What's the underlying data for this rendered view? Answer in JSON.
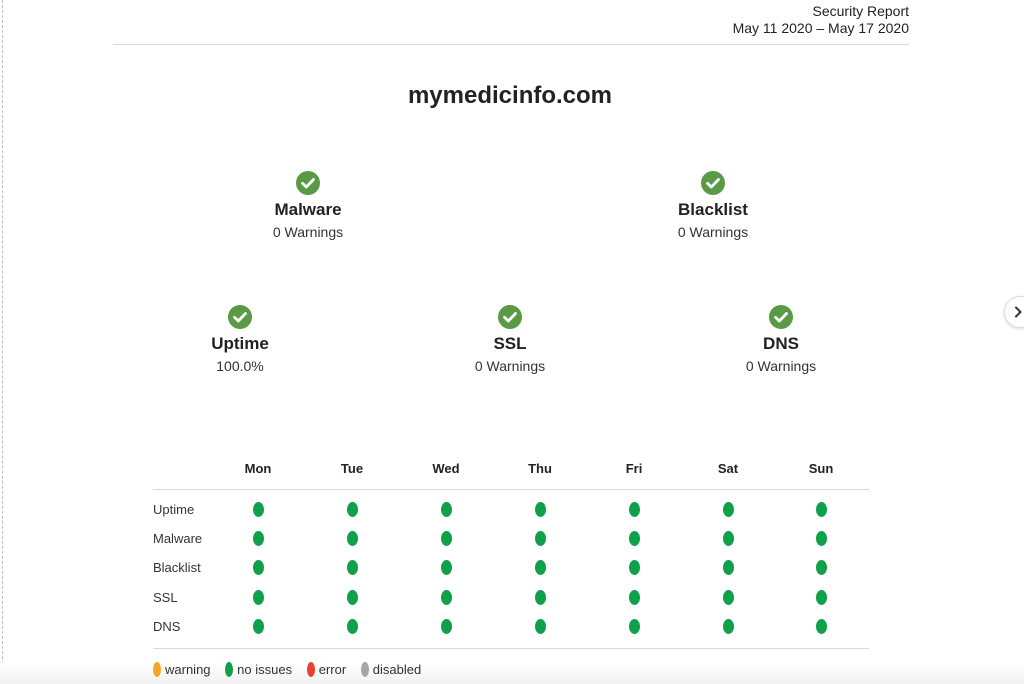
{
  "header": {
    "report_title": "Security Report",
    "date_range": "May 11 2020 – May 17 2020"
  },
  "site": {
    "domain": "mymedicinfo.com"
  },
  "summary": {
    "malware": {
      "label": "Malware",
      "value": "0 Warnings",
      "status": "ok"
    },
    "blacklist": {
      "label": "Blacklist",
      "value": "0 Warnings",
      "status": "ok"
    },
    "uptime": {
      "label": "Uptime",
      "value": "100.0%",
      "status": "ok"
    },
    "ssl": {
      "label": "SSL",
      "value": "0 Warnings",
      "status": "ok"
    },
    "dns": {
      "label": "DNS",
      "value": "0 Warnings",
      "status": "ok"
    }
  },
  "schedule": {
    "days": [
      "Mon",
      "Tue",
      "Wed",
      "Thu",
      "Fri",
      "Sat",
      "Sun"
    ],
    "rows": [
      {
        "label": "Uptime",
        "statuses": [
          "no issues",
          "no issues",
          "no issues",
          "no issues",
          "no issues",
          "no issues",
          "no issues"
        ]
      },
      {
        "label": "Malware",
        "statuses": [
          "no issues",
          "no issues",
          "no issues",
          "no issues",
          "no issues",
          "no issues",
          "no issues"
        ]
      },
      {
        "label": "Blacklist",
        "statuses": [
          "no issues",
          "no issues",
          "no issues",
          "no issues",
          "no issues",
          "no issues",
          "no issues"
        ]
      },
      {
        "label": "SSL",
        "statuses": [
          "no issues",
          "no issues",
          "no issues",
          "no issues",
          "no issues",
          "no issues",
          "no issues"
        ]
      },
      {
        "label": "DNS",
        "statuses": [
          "no issues",
          "no issues",
          "no issues",
          "no issues",
          "no issues",
          "no issues",
          "no issues"
        ]
      }
    ]
  },
  "legend": [
    {
      "label": "warning",
      "color": "#f5a623"
    },
    {
      "label": "no issues",
      "color": "#0fa14a"
    },
    {
      "label": "error",
      "color": "#e8412c"
    },
    {
      "label": "disabled",
      "color": "#a6a6a6"
    }
  ],
  "colors": {
    "check": "#5a9a45",
    "no_issues": "#0fa14a"
  },
  "icons": {
    "status_ok": "check-circle-icon",
    "next": "chevron-right-icon"
  }
}
